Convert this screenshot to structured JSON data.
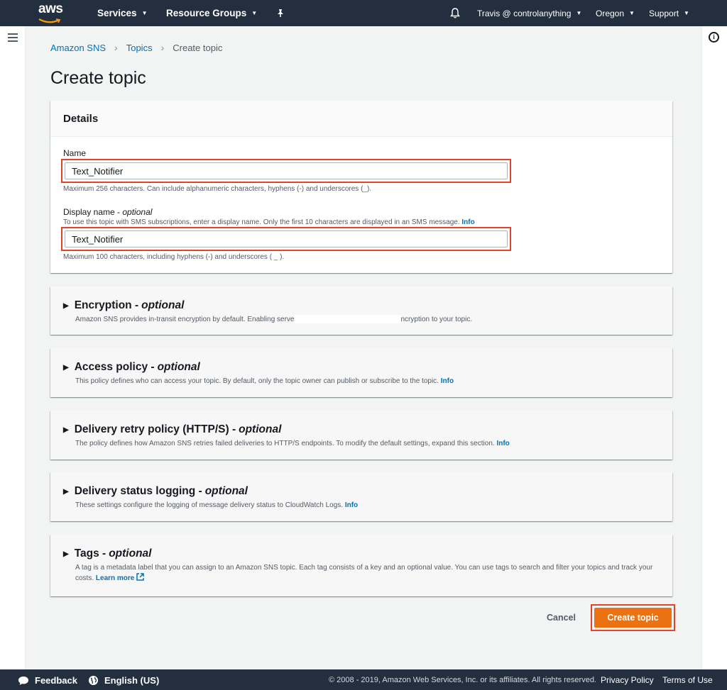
{
  "topnav": {
    "logo": "aws",
    "services": "Services",
    "resource_groups": "Resource Groups",
    "user": "Travis @ controlanything",
    "region": "Oregon",
    "support": "Support"
  },
  "breadcrumb": [
    "Amazon SNS",
    "Topics",
    "Create topic"
  ],
  "page_title": "Create topic",
  "details": {
    "header": "Details",
    "name_label": "Name",
    "name_value": "Text_Notifier",
    "name_hint": "Maximum 256 characters. Can include alphanumeric characters, hyphens (-) and underscores (_).",
    "display_label": "Display name - ",
    "display_label_opt": "optional",
    "display_desc": "To use this topic with SMS subscriptions, enter a display name. Only the first 10 characters are displayed in an SMS message.",
    "display_desc_link": "Info",
    "display_value": "Text_Notifier",
    "display_hint": "Maximum 100 characters, including hyphens (-) and underscores ( _ )."
  },
  "sections": [
    {
      "title": "Encryption - ",
      "opt": "optional",
      "desc_a": "Amazon SNS provides in-transit encryption by default. Enabling serve",
      "desc_b": "ncryption to your topic.",
      "link": ""
    },
    {
      "title": "Access policy - ",
      "opt": "optional",
      "desc_a": "This policy defines who can access your topic. By default, only the topic owner can publish or subscribe to the topic.",
      "link": "Info"
    },
    {
      "title": "Delivery retry policy (HTTP/S) - ",
      "opt": "optional",
      "desc_a": "The policy defines how Amazon SNS retries failed deliveries to HTTP/S endpoints. To modify the default settings, expand this section.",
      "link": "Info"
    },
    {
      "title": "Delivery status logging - ",
      "opt": "optional",
      "desc_a": "These settings configure the logging of message delivery status to CloudWatch Logs.",
      "link": "Info"
    },
    {
      "title": "Tags - ",
      "opt": "optional",
      "desc_a": "A tag is a metadata label that you can assign to an Amazon SNS topic. Each tag consists of a key and an optional value. You can use tags to search and filter your topics and track your costs.",
      "link": "Learn more"
    }
  ],
  "actions": {
    "cancel": "Cancel",
    "create": "Create topic"
  },
  "footer": {
    "feedback": "Feedback",
    "language": "English (US)",
    "copyright": "© 2008 - 2019, Amazon Web Services, Inc. or its affiliates. All rights reserved.",
    "privacy": "Privacy Policy",
    "terms": "Terms of Use"
  },
  "colors": {
    "nav": "#232f3e",
    "accent": "#ec7211",
    "link": "#0073bb",
    "highlight": "#e1442c"
  },
  "icons": [
    "hamburger-menu-icon",
    "info-icon",
    "bell-icon",
    "pin-icon",
    "chevron-right-icon",
    "triangle-right-icon",
    "external-link-icon",
    "speech-bubble-icon",
    "globe-icon"
  ]
}
